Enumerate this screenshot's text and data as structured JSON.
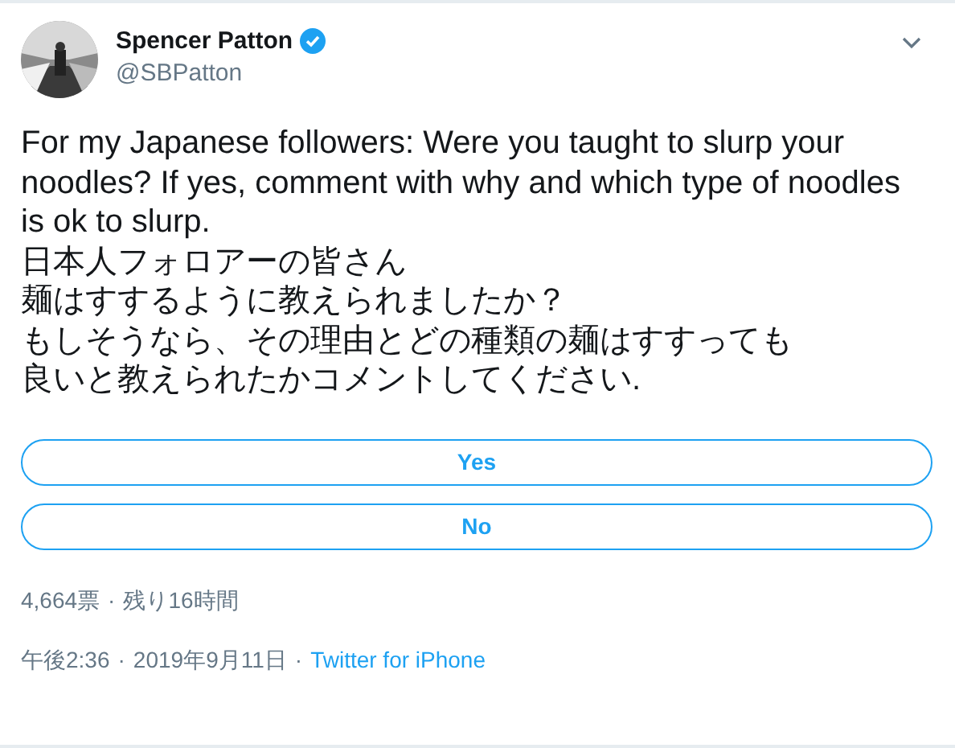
{
  "author": {
    "name": "Spencer Patton",
    "handle": "@SBPatton",
    "verified": true
  },
  "body": {
    "english": "For my Japanese followers: Were you taught to slurp your noodles? If yes, comment with why and which type of noodles is ok to slurp.",
    "japanese_lines": [
      "日本人フォロアーの皆さん",
      "麺はすするように教えられましたか？",
      "もしそうなら、その理由とどの種類の麺はすすっても",
      "良いと教えられたかコメントしてください."
    ]
  },
  "poll": {
    "options": [
      "Yes",
      "No"
    ],
    "votes": "4,664票",
    "time_left": "残り16時間"
  },
  "separator": "·",
  "footer": {
    "time": "午後2:36",
    "date": "2019年9月11日",
    "source": "Twitter for iPhone"
  }
}
